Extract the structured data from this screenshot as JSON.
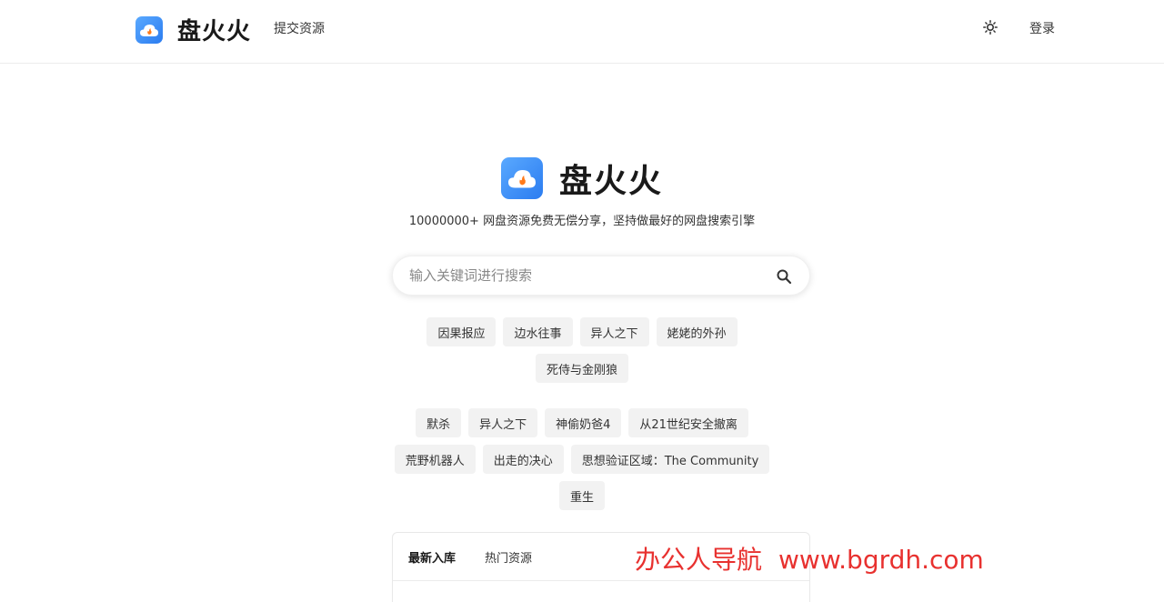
{
  "header": {
    "brand_name": "盘火火",
    "nav_submit": "提交资源",
    "login": "登录",
    "theme_icon": "sun-icon"
  },
  "hero": {
    "title": "盘火火",
    "slogan": "10000000+ 网盘资源免费无偿分享，坚持做最好的网盘搜索引擎"
  },
  "search": {
    "placeholder": "输入关键词进行搜索",
    "value": "",
    "icon": "search-icon"
  },
  "hot_tags": [
    "因果报应",
    "边水往事",
    "异人之下",
    "姥姥的外孙",
    "死侍与金刚狼"
  ],
  "trending_tags": [
    "默杀",
    "异人之下",
    "神偷奶爸4",
    "从21世纪安全撤离",
    "荒野机器人",
    "出走的决心",
    "思想验证区域：The Community",
    "重生"
  ],
  "panel": {
    "tabs": [
      "最新入库",
      "热门资源"
    ],
    "active_tab": 0
  },
  "watermark": {
    "left": "办公人导航",
    "right": "www.bgrdh.com"
  },
  "colors": {
    "accent": "#2b7cf0",
    "tag_bg": "#f2f2f2",
    "watermark": "#e8312f"
  }
}
